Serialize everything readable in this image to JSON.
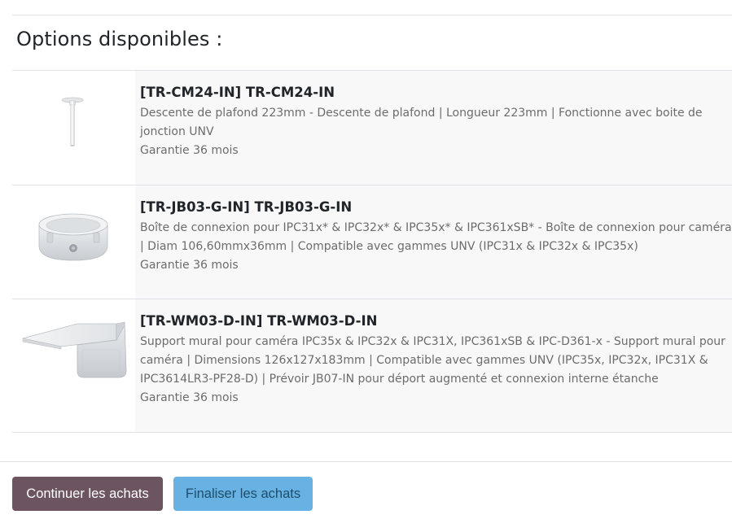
{
  "section": {
    "title": "Options disponibles :"
  },
  "options": [
    {
      "title": "[TR-CM24-IN] TR-CM24-IN",
      "description": "Descente de plafond 223mm - Descente de plafond | Longueur 223mm | Fonctionne avec boite de jonction UNV",
      "warranty": "Garantie 36 mois",
      "image_icon": "ceiling-mount-pole-icon"
    },
    {
      "title": "[TR-JB03-G-IN] TR-JB03-G-IN",
      "description": "Boîte de connexion pour IPC31x* & IPC32x* & IPC35x* & IPC361xSB* - Boîte de connexion pour caméra | Diam 106,60mmx36mm | Compatible avec gammes UNV (IPC31x & IPC32x & IPC35x)",
      "warranty": "Garantie 36 mois",
      "image_icon": "junction-box-icon"
    },
    {
      "title": "[TR-WM03-D-IN] TR-WM03-D-IN",
      "description": "Support mural pour caméra IPC35x & IPC32x & IPC31X, IPC361xSB & IPC-D361-x - Support mural pour caméra | Dimensions 126x127x183mm | Compatible avec gammes UNV (IPC35x, IPC32x, IPC31X & IPC3614LR3-PF28-D) | Prévoir JB07-IN pour déport augmenté et connexion interne étanche",
      "warranty": "Garantie 36 mois",
      "image_icon": "wall-mount-bracket-icon"
    }
  ],
  "actions": {
    "continue_label": "Continuer les achats",
    "finalize_label": "Finaliser les achats"
  },
  "colors": {
    "continue_button": "#6d5461",
    "finalize_button": "#67b2e2",
    "row_background": "#f8f8f8",
    "muted_text": "#6c6c6c"
  }
}
